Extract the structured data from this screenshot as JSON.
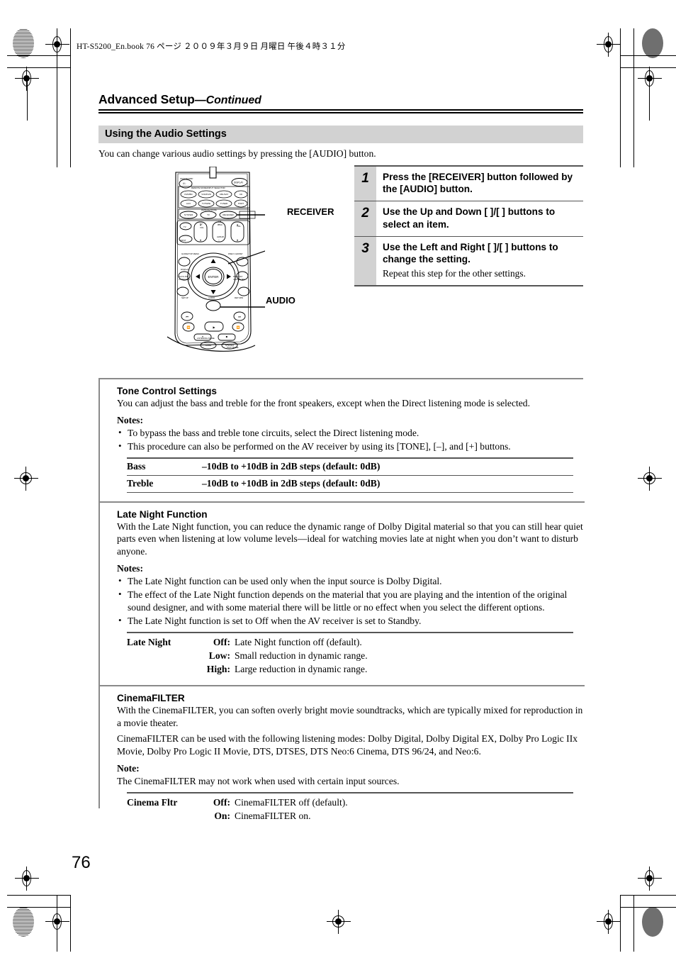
{
  "print_marks": {
    "file_line": "HT-S5200_En.book   76 ページ   ２００９年３月９日   月曜日   午後４時３１分"
  },
  "header": {
    "title": "Advanced Setup",
    "title_continued": "—Continued"
  },
  "section": {
    "banner": "Using the Audio Settings",
    "intro": "You can change various audio settings by pressing the [AUDIO] button."
  },
  "remote": {
    "callout_receiver": "RECEIVER",
    "callout_audio": "AUDIO"
  },
  "steps": [
    {
      "number": "1",
      "heading": "Press the [RECEIVER] button followed by the [AUDIO] button.",
      "sub": ""
    },
    {
      "number": "2",
      "heading": "Use the Up and Down [    ]/[    ] buttons to select an item.",
      "sub": ""
    },
    {
      "number": "3",
      "heading": "Use the Left and Right [    ]/[    ] buttons to change the setting.",
      "sub": "Repeat this step for the other settings."
    }
  ],
  "tone_control": {
    "heading": "Tone Control Settings",
    "body": "You can adjust the bass and treble for the front speakers, except when the Direct listening mode is selected.",
    "notes_label": "Notes:",
    "notes": [
      "To bypass the bass and treble tone circuits, select the Direct listening mode.",
      "This procedure can also be performed on the AV receiver by using its [TONE], [–], and [+] buttons."
    ],
    "rows": [
      {
        "name": "Bass",
        "value": "–10dB to +10dB in 2dB steps (default: 0dB)"
      },
      {
        "name": "Treble",
        "value": "–10dB to +10dB in 2dB steps (default: 0dB)"
      }
    ]
  },
  "late_night": {
    "heading": "Late Night Function",
    "body": "With the Late Night function, you can reduce the dynamic range of Dolby Digital material so that you can still hear quiet parts even when listening at low volume levels—ideal for watching movies late at night when you don’t want to disturb anyone.",
    "notes_label": "Notes:",
    "notes": [
      "The Late Night function can be used only when the input source is Dolby Digital.",
      "The effect of the Late Night function depends on the material that you are playing and the intention of the original sound designer, and with some material there will be little or no effect when you select the different options.",
      "The Late Night function is set to Off when the AV receiver is set to Standby."
    ],
    "table_name": "Late Night",
    "options": [
      {
        "key": "Off:",
        "desc": "Late Night function off (default)."
      },
      {
        "key": "Low:",
        "desc": "Small reduction in dynamic range."
      },
      {
        "key": "High:",
        "desc": "Large reduction in dynamic range."
      }
    ]
  },
  "cinema_filter": {
    "heading": "CinemaFILTER",
    "body1": "With the CinemaFILTER, you can soften overly bright movie soundtracks, which are typically mixed for reproduction in a movie theater.",
    "body2": "CinemaFILTER can be used with the following listening modes: Dolby Digital, Dolby Digital EX, Dolby Pro Logic IIx Movie, Dolby Pro Logic II Movie, DTS, DTSES, DTS Neo:6 Cinema, DTS 96/24, and Neo:6.",
    "note_label": "Note:",
    "note": "The CinemaFILTER may not work when used with certain input sources.",
    "table_name": "Cinema Fltr",
    "options": [
      {
        "key": "Off:",
        "desc": "CinemaFILTER off (default)."
      },
      {
        "key": "On:",
        "desc": "CinemaFILTER on."
      }
    ]
  },
  "footer": {
    "page_number": "76"
  }
}
